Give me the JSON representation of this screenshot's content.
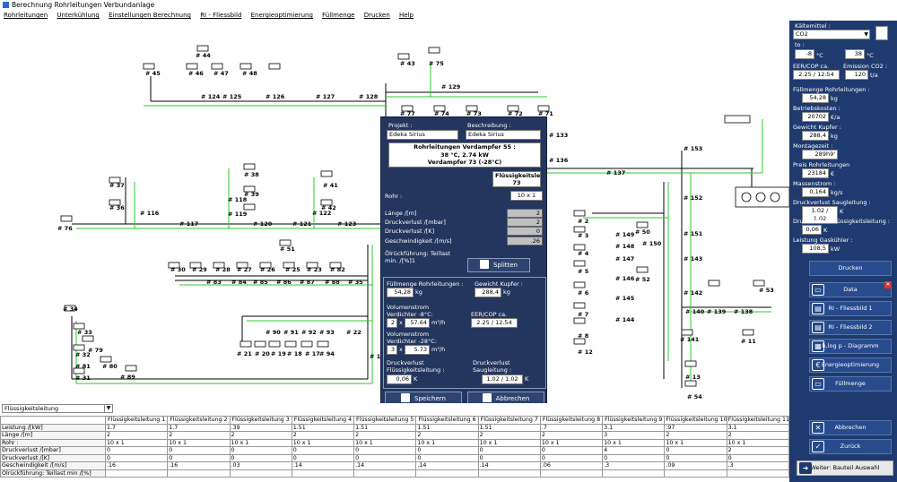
{
  "window": {
    "title": "Berechnung Rohrleitungen Verbundanlage"
  },
  "menu": [
    "Rohrleitungen",
    "Unterkühlung",
    "Einstellungen Berechnung",
    "RI - Fliessbild",
    "Energieoptimierung",
    "Füllmenge",
    "Drucken",
    "Help"
  ],
  "diagram": {
    "node_labels": [
      "# 44",
      "# 45",
      "# 46",
      "# 47",
      "# 48",
      "# 43",
      "# 75",
      "# 124",
      "# 125",
      "# 126",
      "# 127",
      "# 128",
      "# 129",
      "# 77",
      "# 74",
      "# 73",
      "# 72",
      "# 71",
      "# 133",
      "# 136",
      "# 137",
      "# 153",
      "# 152",
      "# 151",
      "# 150",
      "# 149",
      "# 148",
      "# 147",
      "# 146",
      "# 145",
      "# 144",
      "# 143",
      "# 142",
      "# 140",
      "# 139",
      "# 138",
      "# 141",
      "# 50",
      "# 52",
      "# 53",
      "# 11",
      "# 13",
      "# 54",
      "# 37",
      "# 36",
      "# 116",
      "# 76",
      "# 117",
      "# 118",
      "# 119",
      "# 38",
      "# 39",
      "# 120",
      "# 121",
      "# 51",
      "# 41",
      "# 42",
      "# 122",
      "# 123",
      "# 30",
      "# 29",
      "# 28",
      "# 27",
      "# 26",
      "# 25",
      "# 23",
      "# 82",
      "# 83",
      "# 84",
      "# 85",
      "# 86",
      "# 87",
      "# 88",
      "# 35",
      "# 34",
      "# 33",
      "# 79",
      "# 32",
      "# 80",
      "# 81",
      "# 31",
      "# 89",
      "# 90",
      "# 91",
      "# 92",
      "# 93",
      "# 22",
      "# 21",
      "# 20",
      "# 19",
      "# 18",
      "# 17",
      "# 94",
      "# 1",
      "# 2",
      "# 3",
      "# 4",
      "# 5",
      "# 6",
      "# 7",
      "# 8",
      "# 12"
    ]
  },
  "dialog": {
    "projekt_label": "Projekt :",
    "projekt_value": "Edeka Sirius",
    "beschreibung_label": "Beschreibung :",
    "beschreibung_value": "Edeka Sirius",
    "header_line1": "Rohrleitungen Verdampfer 55 :",
    "header_line2": "38 °C,  2.74 kW",
    "header_line3": "Verdampfer 73 (-28°C)",
    "fl_line1": "Flüssigkeitsleitung",
    "fl_line2": "73",
    "rohr_label": "Rohr :",
    "rohr_value": "10 x 1",
    "laenge_label": "Länge /[m]",
    "laenge_value": "2",
    "dv_mbar_label": "Druckverlust /[mbar]",
    "dv_mbar_value": "2",
    "dv_k_label": "Druckverlust /[K]",
    "dv_k_value": "0",
    "geschw_label": "Geschwindigkeit /[m/s]",
    "geschw_value": ".26",
    "oel_label1": "Ölrückführung: Teillast",
    "oel_label2": "min. /[%]1",
    "splitten": "Splitten",
    "fuellmenge_label": "Füllmenge  Rohrleitungen :",
    "fuellmenge_value": "54,28",
    "fuellmenge_unit": "kg",
    "gewicht_label": "Gewicht Kupfer :",
    "gewicht_value": "288,4",
    "gewicht_unit": "kg",
    "vol1_label1": "Volumenstrom",
    "vol1_label2": "Verdichter -8°C:",
    "vol1_count": "2",
    "vol1_x": "x",
    "vol1_value": "57.64",
    "vol1_unit": "m³/h",
    "eer_label": "EER/COP ca.",
    "eer_value": "2.25 / 12.54",
    "vol2_label1": "Volumenstrom",
    "vol2_label2": "Verdichter -28°C:",
    "vol2_count": "3",
    "vol2_x": "x",
    "vol2_value": "5.73",
    "vol2_unit": "m³/h",
    "dvfl_label1": "Druckverlust",
    "dvfl_label2": "Flüssigkeitsleitung :",
    "dvfl_value": "0,06",
    "dvfl_unit": "K",
    "dvsl_label1": "Druckverlust",
    "dvsl_label2": "Saugleitung :",
    "dvsl_value": "1.02 / 1.02",
    "dvsl_unit": "K",
    "speichern": "Speichern",
    "abbrechen": "Abbrechen"
  },
  "right_panel": {
    "kaeltemittel_label": "Kältemittel :",
    "kaeltemittel_value": "CO2",
    "to_label": "to :",
    "to_value": "-8",
    "to_unit": "°C",
    "tc_value": "38",
    "tc_unit": "°C",
    "eer_label": "EER/COP ca.",
    "eer_value": "2.25 / 12.54",
    "emission_label": "Emission CO2 :",
    "emission_value": "120",
    "emission_unit": "t/a",
    "fuellmenge_label": "Füllmenge  Rohrleitungen :",
    "fuellmenge_value": "54,28",
    "fuellmenge_unit": "kg",
    "betrieb_label": "Betriebskosten :",
    "betrieb_value": "20702",
    "betrieb_unit": "€/a",
    "gewicht_label": "Gewicht Kupfer :",
    "gewicht_value": "288,4",
    "gewicht_unit": "kg",
    "montage_label": "Montagezeit :",
    "montage_value": "289h9'",
    "preis_label": "Preis Rohrleitungen",
    "preis_value": "23184",
    "preis_unit": "€",
    "massen_label": "Massenstrom :",
    "massen_value": "0,164",
    "massen_unit": "kg/s",
    "dvs_label": "Druckverlust Saugleitung :",
    "dvs_value": "1.02 / 1.02",
    "dvs_unit": "K",
    "dvf_label": "Druckverlust Flüssigkeitsleitung :",
    "dvf_value": "0,06",
    "dvf_unit": "K",
    "leistung_label": "Leistung Gaskühler :",
    "leistung_value": "108,5",
    "leistung_unit": "kW",
    "btn_drucken": "Drucken",
    "btn_data": "Data",
    "btn_ri1": "RI - Fliessbild 1",
    "btn_ri2": "RI - Fliessbild 2",
    "btn_hlog": "h,log p - Diagramm",
    "btn_energie": "Energieoptimierung",
    "btn_fuell": "Füllmenge",
    "btn_abbrechen": "Abbrechen",
    "btn_zurueck": "Zurück",
    "btn_weiter": "Weiter: Bauteil Auswahl"
  },
  "bottom": {
    "select_value": "Flüssigkeitsleitung",
    "columns": [
      "Flüssigkeitsleitung 1",
      "Flüssigkeitsleitung 2",
      "Flüssigkeitsleitung 3",
      "Flüssigkeitsleitung 4",
      "Flüssigkeitsleitung 5",
      "Flüssigkeitsleitung 6",
      "Flüssigkeitsleitung 7",
      "Flüssigkeitsleitung 8",
      "Flüssigkeitsleitung 9",
      "Flüssigkeitsleitung 10",
      "Flüssigkeitsleitung 11"
    ],
    "rows": [
      {
        "label": "Leistung /[kW]",
        "values": [
          "1.7",
          "1.7",
          ".39",
          "1.51",
          "1.51",
          "1.51",
          "1.51",
          ".7",
          "3.1",
          ".97",
          "3.1"
        ]
      },
      {
        "label": "Länge /[m]",
        "values": [
          "2",
          "2",
          "2",
          "2",
          "2",
          "2",
          "2",
          "2",
          "3",
          "2",
          "2"
        ]
      },
      {
        "label": "Rohr :",
        "values": [
          "10 x 1",
          "10 x 1",
          "10 x 1",
          "10 x 1",
          "10 x 1",
          "10 x 1",
          "10 x 1",
          "10 x 1",
          "10 x 1",
          "10 x 1",
          "10 x 1"
        ]
      },
      {
        "label": "Druckverlust /[mbar]",
        "values": [
          "0",
          "0",
          "0",
          "0",
          "0",
          "0",
          "0",
          "0",
          "4",
          "0",
          "2"
        ]
      },
      {
        "label": "Druckverlust /[K]",
        "values": [
          "0",
          "0",
          "0",
          "0",
          "0",
          "0",
          "0",
          "0",
          "0",
          "0",
          "0"
        ]
      },
      {
        "label": "Geschwindigkeit /[m/s]",
        "values": [
          ".16",
          ".16",
          ".03",
          ".14",
          ".14",
          ".14",
          ".14",
          ".06",
          ".3",
          ".09",
          ".3"
        ]
      },
      {
        "label": "Ölrückführung: Teillast min /[%]",
        "values": [
          "",
          "",
          "",
          "",
          "",
          "",
          "",
          "",
          "",
          "",
          ""
        ]
      }
    ]
  }
}
